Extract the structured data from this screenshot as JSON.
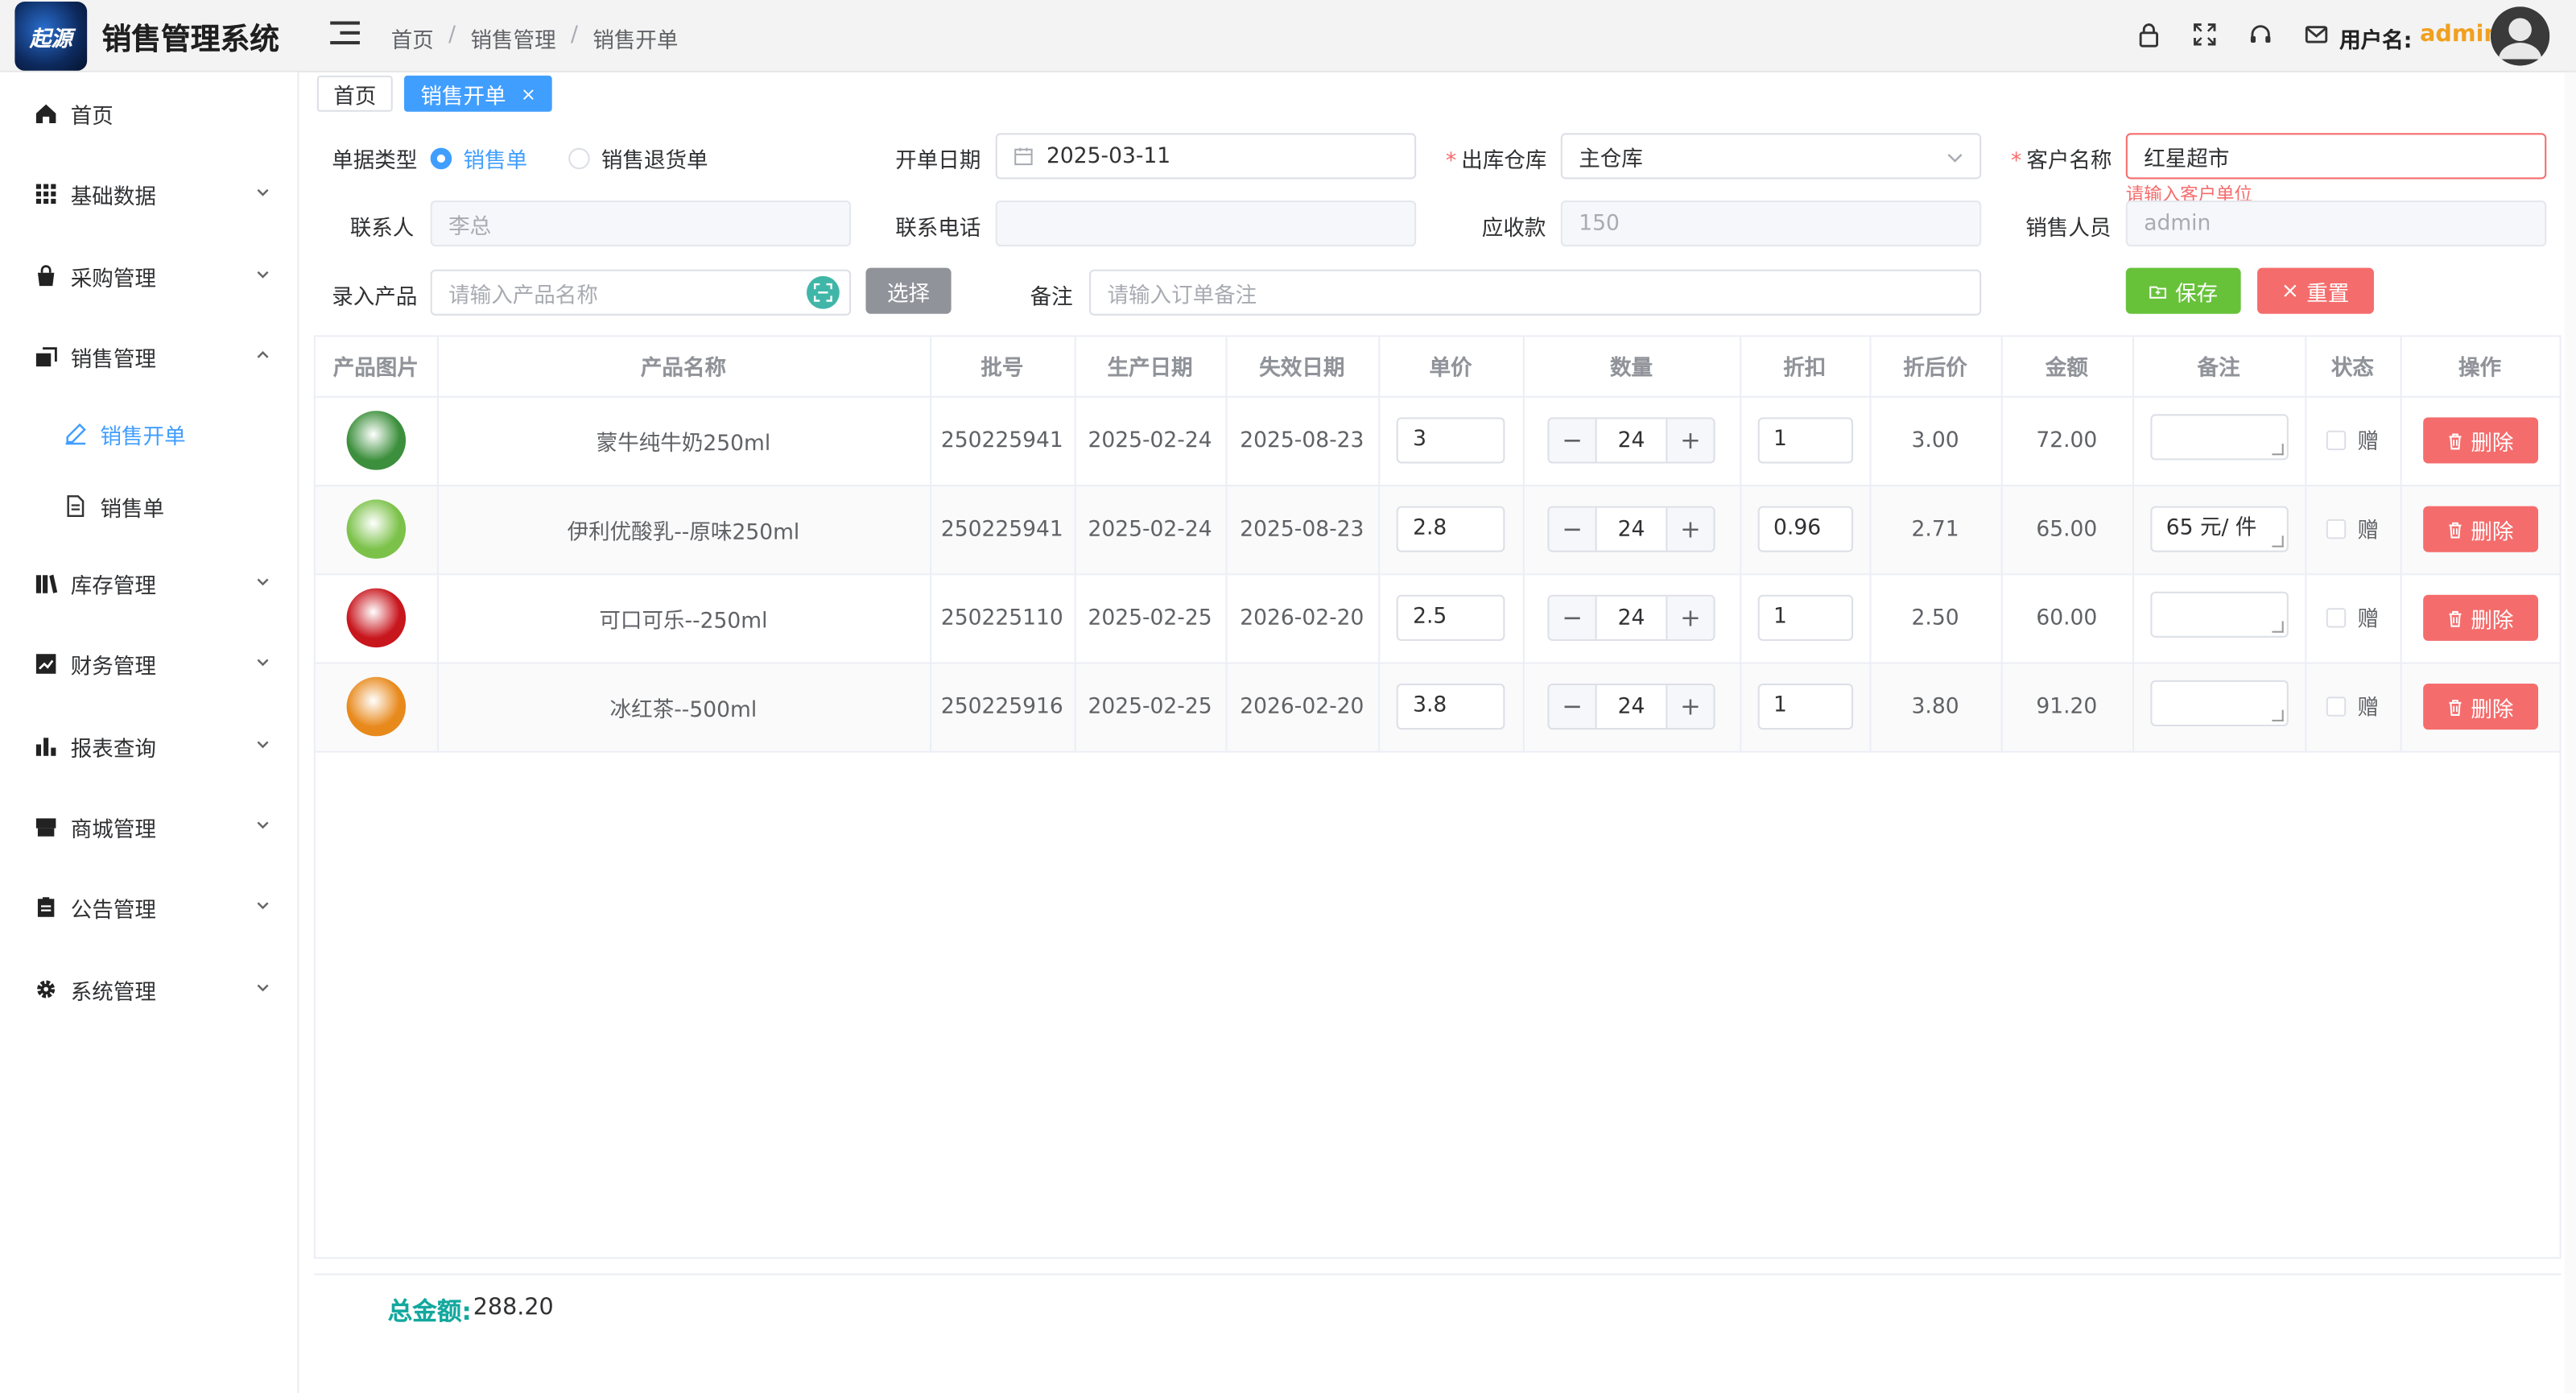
{
  "app": {
    "logo_text": "起源",
    "title": "销售管理系统"
  },
  "breadcrumb": [
    "首页",
    "销售管理",
    "销售开单"
  ],
  "header": {
    "user_label": "用户名:",
    "user_name": "admin",
    "icons": [
      "lock-icon",
      "fullscreen-icon",
      "headset-icon",
      "mail-icon"
    ]
  },
  "sidebar": {
    "items": [
      {
        "label": "首页",
        "icon": "home-icon",
        "expandable": false
      },
      {
        "label": "基础数据",
        "icon": "grid-icon",
        "expandable": true
      },
      {
        "label": "采购管理",
        "icon": "bag-icon",
        "expandable": true
      },
      {
        "label": "销售管理",
        "icon": "sale-icon",
        "expandable": true,
        "expanded": true
      },
      {
        "label": "库存管理",
        "icon": "books-icon",
        "expandable": true
      },
      {
        "label": "财务管理",
        "icon": "chart-icon",
        "expandable": true
      },
      {
        "label": "报表查询",
        "icon": "bar-chart-icon",
        "expandable": true
      },
      {
        "label": "商城管理",
        "icon": "shop-icon",
        "expandable": true
      },
      {
        "label": "公告管理",
        "icon": "clipboard-icon",
        "expandable": true
      },
      {
        "label": "系统管理",
        "icon": "gear-icon",
        "expandable": true
      }
    ],
    "sub_items": [
      {
        "label": "销售开单",
        "icon": "edit-icon",
        "active": true
      },
      {
        "label": "销售单",
        "icon": "document-icon",
        "active": false
      }
    ]
  },
  "tabs": [
    {
      "label": "首页",
      "active": false
    },
    {
      "label": "销售开单",
      "active": true,
      "close": "×"
    }
  ],
  "form": {
    "doc_type_label": "单据类型",
    "doc_type_options": [
      "销售单",
      "销售退货单"
    ],
    "doc_type_selected": "销售单",
    "date_label": "开单日期",
    "date_value": "2025-03-11",
    "warehouse_label": "出库仓库",
    "warehouse_value": "主仓库",
    "customer_label": "客户名称",
    "customer_value": "红星超市",
    "customer_error": "请输入客户单位",
    "contact_label": "联系人",
    "contact_value": "李总",
    "phone_label": "联系电话",
    "phone_value": "",
    "receivable_label": "应收款",
    "receivable_value": "150",
    "salesperson_label": "销售人员",
    "salesperson_value": "admin",
    "product_label": "录入产品",
    "product_placeholder": "请输入产品名称",
    "choose_button": "选择",
    "remark_label": "备注",
    "remark_placeholder": "请输入订单备注",
    "save_button": "保存",
    "reset_button": "重置"
  },
  "table": {
    "headers": [
      "产品图片",
      "产品名称",
      "批号",
      "生产日期",
      "失效日期",
      "单价",
      "数量",
      "折扣",
      "折后价",
      "金额",
      "备注",
      "状态",
      "操作"
    ],
    "rows": [
      {
        "name": "蒙牛纯牛奶250ml",
        "batch": "250225941",
        "mfg": "2025-02-24",
        "exp": "2025-08-23",
        "price": "3",
        "qty": "24",
        "discount": "1",
        "disc_price": "3.00",
        "amount": "72.00",
        "remark": "",
        "status": "赠",
        "action": "删除",
        "img": "milk-carton-image",
        "color": "#3c8f3c"
      },
      {
        "name": "伊利优酸乳--原味250ml",
        "batch": "250225941",
        "mfg": "2025-02-24",
        "exp": "2025-08-23",
        "price": "2.8",
        "qty": "24",
        "discount": "0.96",
        "disc_price": "2.71",
        "amount": "65.00",
        "remark": "65 元/ 件",
        "status": "赠",
        "action": "删除",
        "img": "yogurt-pack-image",
        "color": "#7cc24a"
      },
      {
        "name": "可口可乐--250ml",
        "batch": "250225110",
        "mfg": "2025-02-25",
        "exp": "2026-02-20",
        "price": "2.5",
        "qty": "24",
        "discount": "1",
        "disc_price": "2.50",
        "amount": "60.00",
        "remark": "",
        "status": "赠",
        "action": "删除",
        "img": "cola-can-image",
        "color": "#c8161d"
      },
      {
        "name": "冰红茶--500ml",
        "batch": "250225916",
        "mfg": "2025-02-25",
        "exp": "2026-02-20",
        "price": "3.8",
        "qty": "24",
        "discount": "1",
        "disc_price": "3.80",
        "amount": "91.20",
        "remark": "",
        "status": "赠",
        "action": "删除",
        "img": "tea-bottle-image",
        "color": "#e8891c"
      }
    ],
    "qty_minus": "−",
    "qty_plus": "+"
  },
  "total": {
    "label": "总金额:",
    "value": "288.20"
  },
  "colors": {
    "accent": "#409eff",
    "success": "#67c23a",
    "danger": "#f56c6c",
    "total": "#13a89e",
    "warning": "#f0a020"
  }
}
